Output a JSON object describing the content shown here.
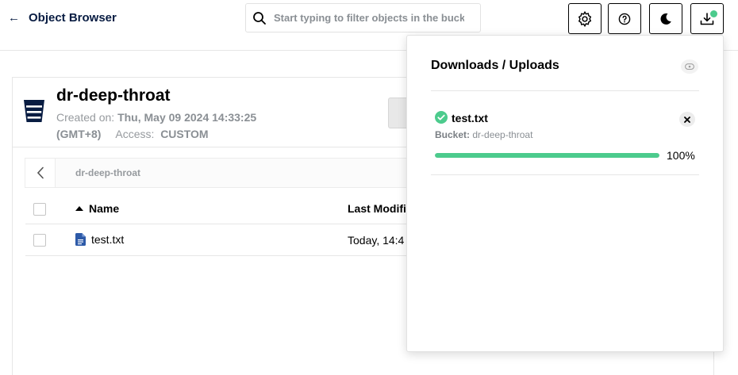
{
  "header": {
    "back_arrow": "←",
    "title": "Object Browser",
    "search_placeholder": "Start typing to filter objects in the bucket",
    "download_indicator_color": "#4ccb8d"
  },
  "bucket": {
    "name": "dr-deep-throat",
    "created_label": "Created on:",
    "created_value": "Thu, May 09 2024 14:33:25",
    "timezone": "(GMT+8)",
    "access_label": "Access:",
    "access_value": "CUSTOM"
  },
  "browser": {
    "breadcrumb": "dr-deep-throat",
    "columns": {
      "name": "Name",
      "last_modified": "Last Modifi"
    },
    "rows": [
      {
        "name": "test.txt",
        "last_modified": "Today, 14:4"
      }
    ]
  },
  "transfers": {
    "title": "Downloads / Uploads",
    "items": [
      {
        "name": "test.txt",
        "bucket_label": "Bucket:",
        "bucket_value": "dr-deep-throat",
        "progress": 100,
        "progress_label": "100%",
        "status": "complete"
      }
    ]
  },
  "colors": {
    "accent": "#081c42",
    "success": "#4ccb8d",
    "muted_text": "#969a9e"
  },
  "icons": {
    "back": "arrow-left-icon",
    "search": "search-icon",
    "settings": "gear-icon",
    "help": "help-circle-icon",
    "theme": "moon-icon",
    "downloads": "download-icon",
    "bucket": "bucket-icon",
    "file": "file-text-icon",
    "status": "check-circle-icon",
    "close": "close-icon",
    "hide": "eye-off-icon"
  }
}
